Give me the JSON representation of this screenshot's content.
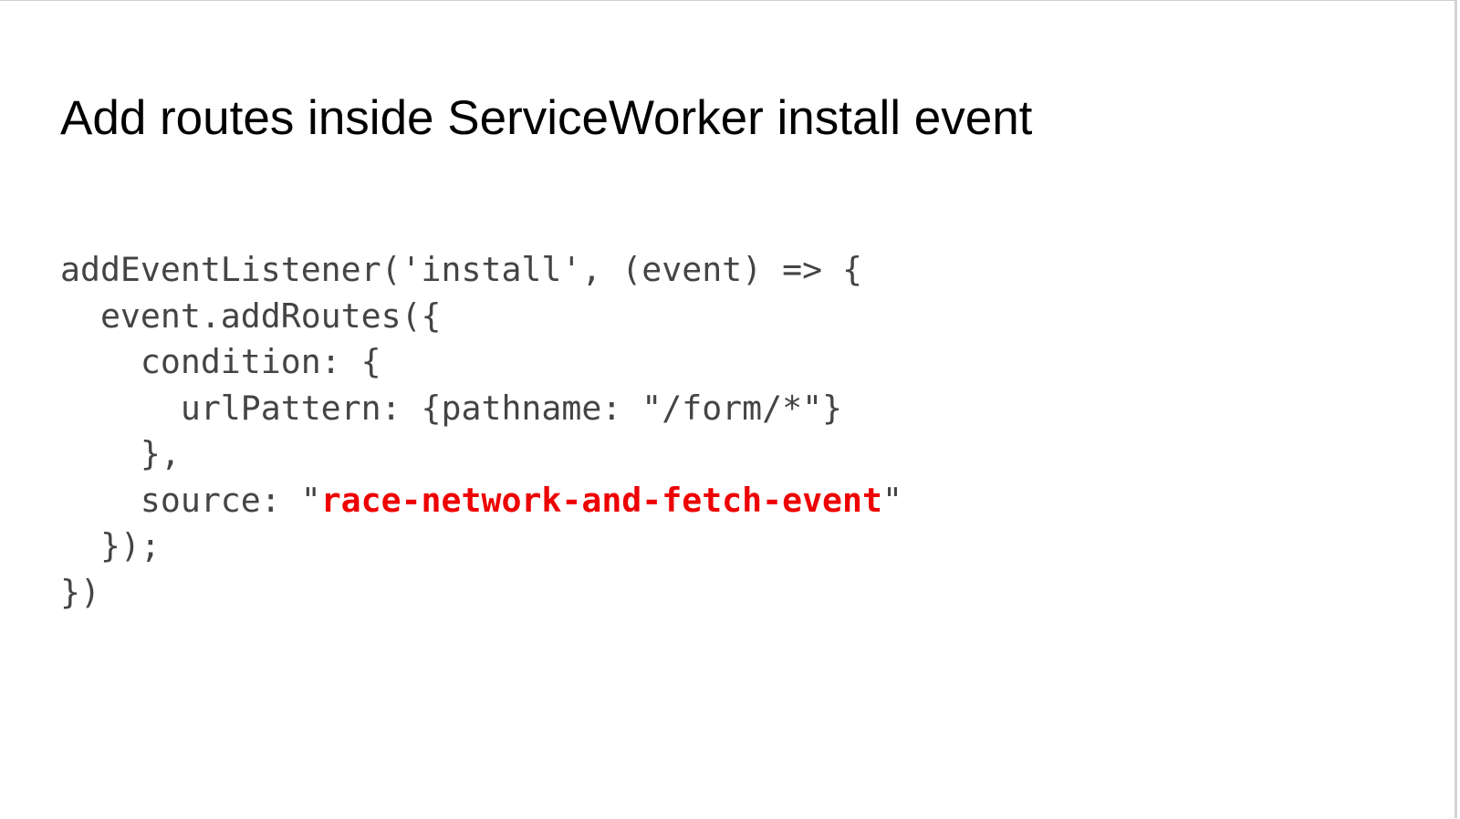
{
  "slide": {
    "title": "Add routes inside ServiceWorker install event",
    "code_lines": [
      "addEventListener('install', (event) => {",
      "  event.addRoutes({",
      "    condition: {",
      "      urlPattern: {pathname: \"/form/*\"}",
      "    },",
      "    source: \"",
      "  });",
      "})"
    ],
    "source_value": "race-network-and-fetch-event",
    "source_suffix": "\""
  },
  "colors": {
    "code_text": "#444444",
    "highlight": "#ee0000",
    "title_text": "#000000",
    "background": "#ffffff"
  }
}
